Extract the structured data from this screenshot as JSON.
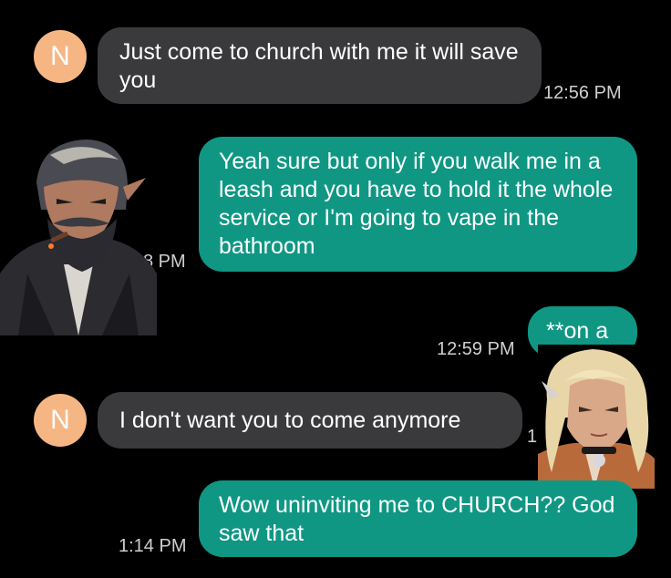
{
  "contact_initial": "N",
  "messages": [
    {
      "direction": "incoming",
      "text": "Just come to church with me it will save you",
      "time": "12:56 PM"
    },
    {
      "direction": "outgoing",
      "text": "Yeah sure but only if you walk me in a leash and you have to hold it the whole service or I'm going to vape in the bathroom",
      "time": "8 PM"
    },
    {
      "direction": "outgoing",
      "text": "**on a",
      "time": "12:59 PM"
    },
    {
      "direction": "incoming",
      "text": "I don't want you to come anymore",
      "time": "1"
    },
    {
      "direction": "outgoing",
      "text": "Wow uninviting me to CHURCH?? God saw that",
      "time": "1:14 PM"
    }
  ],
  "colors": {
    "incoming_bubble": "#3a3a3c",
    "outgoing_bubble": "#0f9784",
    "avatar": "#f6b684",
    "background": "#000000"
  }
}
